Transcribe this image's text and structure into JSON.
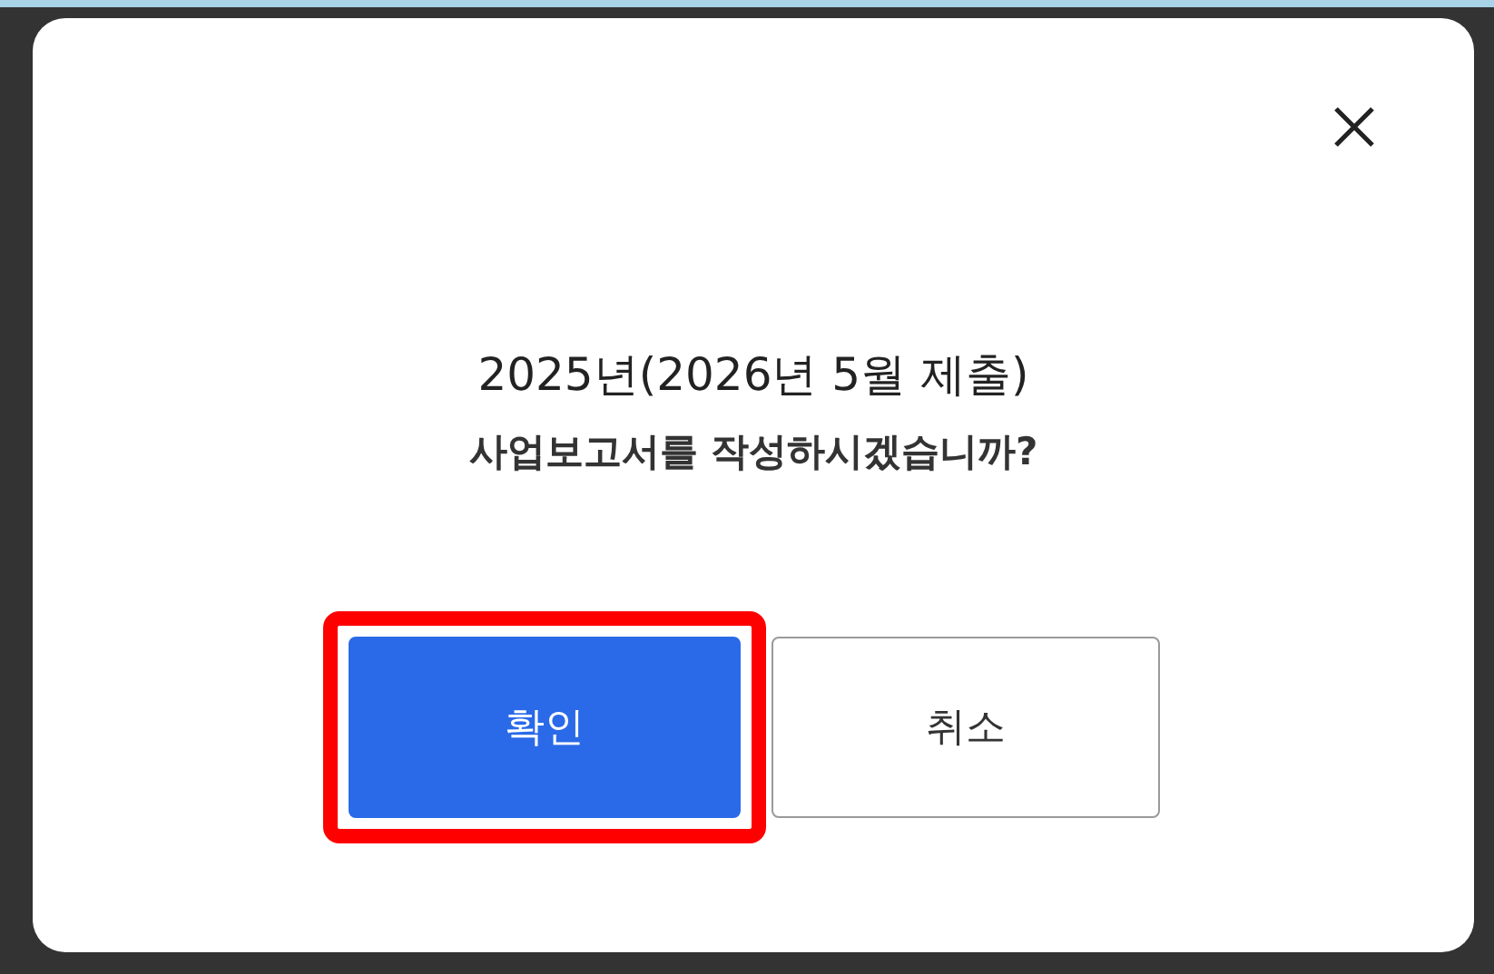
{
  "dialog": {
    "message": [
      "2025년(2026년 5월 제출)",
      "사업보고서를 작성하시겠습니까?"
    ],
    "buttons": [
      {
        "label": "확인",
        "kind": "primary",
        "highlighted": true
      },
      {
        "label": "취소",
        "kind": "secondary",
        "highlighted": false
      }
    ]
  }
}
